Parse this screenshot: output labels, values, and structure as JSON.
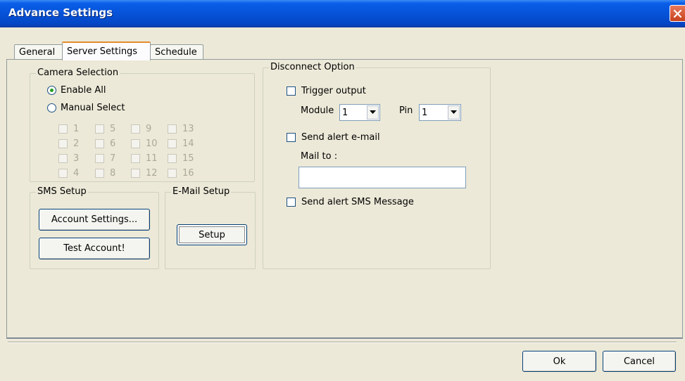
{
  "window": {
    "title": "Advance Settings"
  },
  "tabs": [
    {
      "label": "General",
      "active": false
    },
    {
      "label": "Server Settings",
      "active": true
    },
    {
      "label": "Schedule",
      "active": false
    }
  ],
  "camera_selection": {
    "legend": "Camera Selection",
    "enable_all_label": "Enable All",
    "manual_select_label": "Manual Select",
    "selected": "Enable All",
    "cameras": [
      "1",
      "2",
      "3",
      "4",
      "5",
      "6",
      "7",
      "8",
      "9",
      "10",
      "11",
      "12",
      "13",
      "14",
      "15",
      "16"
    ]
  },
  "sms_setup": {
    "legend": "SMS Setup",
    "account_settings_label": "Account Settings...",
    "test_account_label": "Test Account!"
  },
  "email_setup": {
    "legend": "E-Mail Setup",
    "setup_label": "Setup"
  },
  "disconnect_option": {
    "legend": "Disconnect Option",
    "trigger_output_label": "Trigger output",
    "module_label": "Module",
    "module_value": "1",
    "pin_label": "Pin",
    "pin_value": "1",
    "send_email_label": "Send alert e-mail",
    "mail_to_label": "Mail to :",
    "mail_to_value": "",
    "send_sms_label": "Send alert SMS Message"
  },
  "footer": {
    "ok_label": "Ok",
    "cancel_label": "Cancel"
  },
  "colors": {
    "titlebar": "#0653d8",
    "dialog_bg": "#ece9d8",
    "radio_dot": "#21a121",
    "close_button": "#c7411d"
  }
}
